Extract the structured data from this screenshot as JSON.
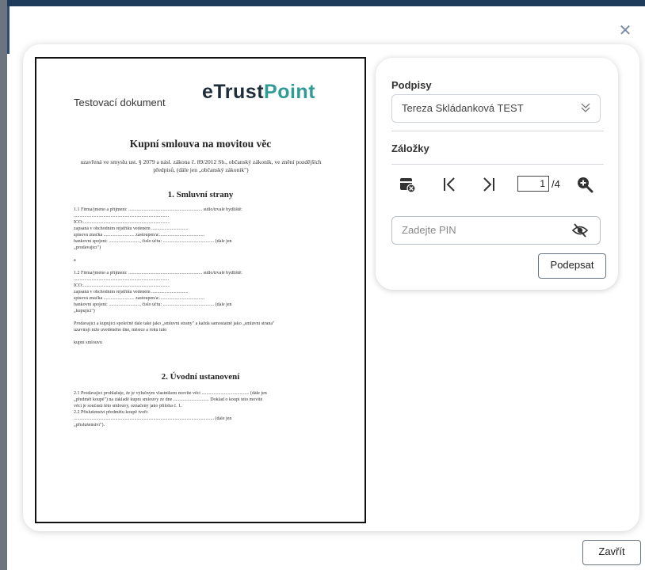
{
  "dialog": {
    "close_label": "Zavřít"
  },
  "document": {
    "header": "Testovací dokument",
    "logo": {
      "part1": "eTrust",
      "part2": "Point",
      "color_dark": "#1f2d3a",
      "color_accent": "#2f9b95"
    },
    "title": "Kupní smlouva na movitou věc",
    "subtitle": "uzavřená ve smyslu ust. § 2079 a násl. zákona č. 89/2012 Sb., občanský zákonik, ve znění pozdějších předpisů, (dále jen „občanský zákonik\")",
    "section1": "1. Smluvní strany",
    "section2": "2. Úvodní ustanovení",
    "lines1": [
      "1.1      Firma/jméno a příjmení: .............................................................. sídlo/trvalé bydliště:",
      "................................................................................",
      "IČO:.........................................................................",
      "zapsaná v obchodním rejstříku vedeném ...............................",
      "spisová značka .......................... zastoupen/a:......................................",
      "bankovní spojení: .........................., číslo účtu: ........................................... (dále jen",
      "„prodávající\")",
      "",
      "a",
      "",
      "1.2      Firma/jméno a příjmení: .............................................................. sídlo/trvalé bydliště:",
      "................................................................................",
      "IČO:.........................................................................",
      "zapsaná v obchodním rejstříku vedeném ...............................",
      "spisová značka .......................... zastoupen/a:......................................",
      "bankovní spojení: .........................., číslo účtu: ........................................... (dále jen",
      "„kupující\")",
      "",
      "Prodávající a kupující společně dále také jako „smluvní strany\" a každá samostatně jako „smluvní strana\"",
      "uzavírají níže uvedeného dne, měsíce a roku tuto",
      "",
      "kupní smlouvu"
    ],
    "lines2": [
      "2.1      Prodávající prohlašuje, že je výlučným vlastníkem movité věci ........................................ (dále jen",
      "„předmět koupě\") na základě kupní smlouvy ze dne .............................. Doklad o koupi této movité",
      "věci je součástí této smlouvy, označený jako příloha č. 1.",
      "2.2      Příslušenství předmětu koupě tvoří:",
      "...................................................................................................................... (dále jen",
      "„příslušenství\")."
    ]
  },
  "side": {
    "signatures_label": "Podpisy",
    "signer_selected": "Tereza Skládanková TEST",
    "bookmarks_label": "Záložky",
    "page_current": "1",
    "page_total": "/4",
    "pin_placeholder": "Zadejte PIN",
    "sign_label": "Podepsat"
  }
}
